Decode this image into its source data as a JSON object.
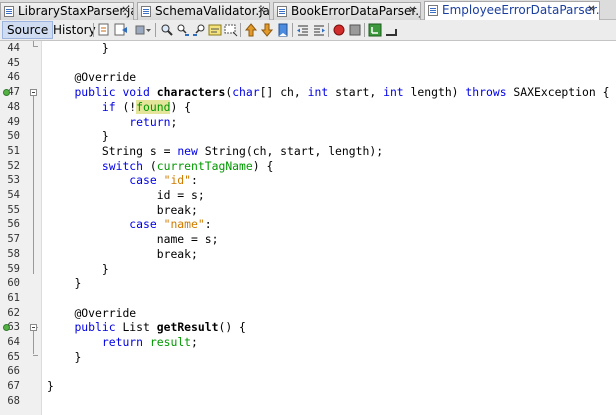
{
  "tabs": [
    {
      "label": "LibraryStaxParser.java",
      "active": false
    },
    {
      "label": "SchemaValidator.java",
      "active": false
    },
    {
      "label": "BookErrorDataParser.java",
      "active": false
    },
    {
      "label": "EmployeeErrorDataParser.java",
      "active": true
    }
  ],
  "close_glyph": "✕",
  "view_tabs": {
    "source": "Source",
    "history": "History"
  },
  "toolbar_icons": [
    "last-edit-icon",
    "back-icon",
    "forward-icon",
    "find-icon",
    "find-previous-icon",
    "find-next-icon",
    "toggle-highlight-icon",
    "toggle-rect-select-icon",
    "previous-bookmark-icon",
    "next-bookmark-icon",
    "toggle-bookmark-icon",
    "shift-left-icon",
    "shift-right-icon",
    "start-macro-icon",
    "stop-macro-icon",
    "comment-icon",
    "uncomment-icon"
  ],
  "colors": {
    "keyword": "#0000e6",
    "string": "#ce7b00",
    "field": "#009900",
    "override_marker": "#55b146",
    "highlight": "#e4e49a"
  },
  "line_numbers": [
    "44",
    "45",
    "46",
    "47",
    "48",
    "49",
    "50",
    "51",
    "52",
    "53",
    "54",
    "55",
    "56",
    "57",
    "58",
    "59",
    "60",
    "61",
    "62",
    "63",
    "64",
    "65",
    "66",
    "67",
    "68"
  ],
  "code": {
    "l44": "}",
    "l46": "@Override",
    "l47_public": "public",
    "l47_void": "void",
    "l47_name": "characters",
    "l47_params_open": "(",
    "l47_char": "char",
    "l47_p1": "[] ch, ",
    "l47_int1": "int",
    "l47_p2": " start, ",
    "l47_int2": "int",
    "l47_p3": " length) ",
    "l47_throws": "throws",
    "l47_rest": " SAXException {",
    "l48_if": "if",
    "l48_a": " (!",
    "l48_found": "found",
    "l48_b": ") {",
    "l49_return": "return",
    "l49_semi": ";",
    "l50": "}",
    "l51_a": "String s = ",
    "l51_new": "new",
    "l51_b": " String(ch, start, length);",
    "l52_switch": "switch",
    "l52_a": " (",
    "l52_field": "currentTagName",
    "l52_b": ") {",
    "l53_case": "case",
    "l53_str": "\"id\"",
    "l53_colon": ":",
    "l54": "id = s;",
    "l55": "break;",
    "l56_case": "case",
    "l56_str": "\"name\"",
    "l56_colon": ":",
    "l57": "name = s;",
    "l58": "break;",
    "l59": "}",
    "l60": "}",
    "l62": "@Override",
    "l63_public": "public",
    "l63_rest": " List ",
    "l63_name": "getResult",
    "l63_tail": "() {",
    "l64_return": "return",
    "l64_field": "result",
    "l64_semi": ";",
    "l65": "}",
    "l67": "}"
  }
}
